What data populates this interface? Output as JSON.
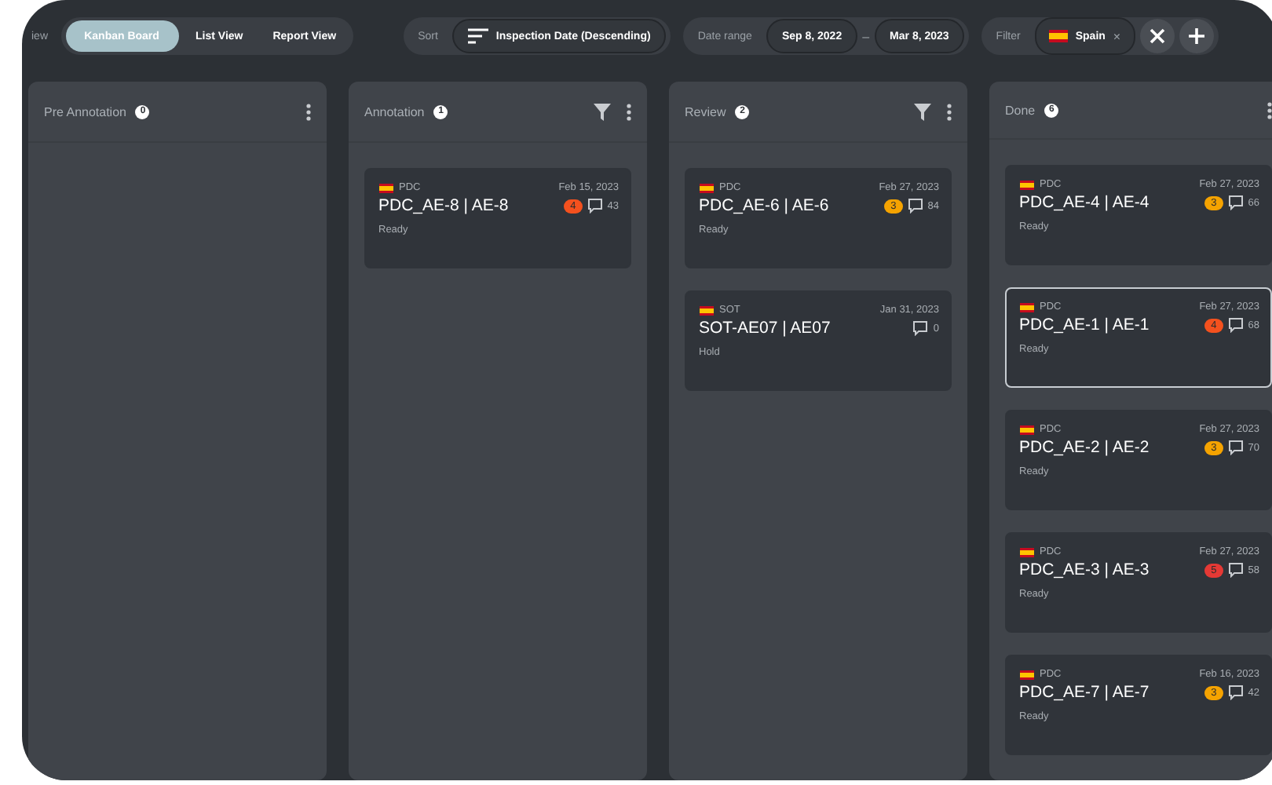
{
  "view_switch": {
    "label": "iew",
    "options": [
      {
        "label": "Kanban Board",
        "selected": true
      },
      {
        "label": "List View",
        "selected": false
      },
      {
        "label": "Report View",
        "selected": false
      }
    ]
  },
  "sort": {
    "label": "Sort",
    "value": "Inspection Date (Descending)"
  },
  "date_range": {
    "label": "Date range",
    "start": "Sep 8, 2022",
    "separator": "–",
    "end": "Mar 8, 2023"
  },
  "filter": {
    "label": "Filter",
    "chips": [
      {
        "label": "Spain",
        "remove": "×"
      }
    ]
  },
  "columns": [
    {
      "title": "Pre Annotation",
      "count": "0",
      "filter_icon": false
    },
    {
      "title": "Annotation",
      "count": "1",
      "filter_icon": true,
      "cards": [
        {
          "site": "PDC",
          "title": "PDC_AE-8 | AE-8",
          "date": "Feb 15, 2023",
          "badge": {
            "count": "4",
            "color": "#f4511e"
          },
          "comments": "43",
          "status": "Ready",
          "selected": false
        }
      ]
    },
    {
      "title": "Review",
      "count": "2",
      "filter_icon": true,
      "cards": [
        {
          "site": "PDC",
          "title": "PDC_AE-6 | AE-6",
          "date": "Feb 27, 2023",
          "badge": {
            "count": "3",
            "color": "#f5a300"
          },
          "comments": "84",
          "status": "Ready",
          "selected": false
        },
        {
          "site": "SOT",
          "title": "SOT-AE07 | AE07",
          "date": "Jan 31, 2023",
          "comments": "0",
          "status": "Hold",
          "selected": false
        }
      ]
    },
    {
      "title": "Done",
      "count": "6",
      "filter_icon": false,
      "cards": [
        {
          "site": "PDC",
          "title": "PDC_AE-4 | AE-4",
          "date": "Feb 27, 2023",
          "badge": {
            "count": "3",
            "color": "#f5a300"
          },
          "comments": "66",
          "status": "Ready",
          "selected": false
        },
        {
          "site": "PDC",
          "title": "PDC_AE-1 | AE-1",
          "date": "Feb 27, 2023",
          "badge": {
            "count": "4",
            "color": "#f4511e"
          },
          "comments": "68",
          "status": "Ready",
          "selected": true
        },
        {
          "site": "PDC",
          "title": "PDC_AE-2 | AE-2",
          "date": "Feb 27, 2023",
          "badge": {
            "count": "3",
            "color": "#f5a300"
          },
          "comments": "70",
          "status": "Ready",
          "selected": false
        },
        {
          "site": "PDC",
          "title": "PDC_AE-3 | AE-3",
          "date": "Feb 27, 2023",
          "badge": {
            "count": "5",
            "color": "#e53935"
          },
          "comments": "58",
          "status": "Ready",
          "selected": false
        },
        {
          "site": "PDC",
          "title": "PDC_AE-7 | AE-7",
          "date": "Feb 16, 2023",
          "badge": {
            "count": "3",
            "color": "#f5a300"
          },
          "comments": "42",
          "status": "Ready",
          "selected": false
        }
      ]
    }
  ]
}
